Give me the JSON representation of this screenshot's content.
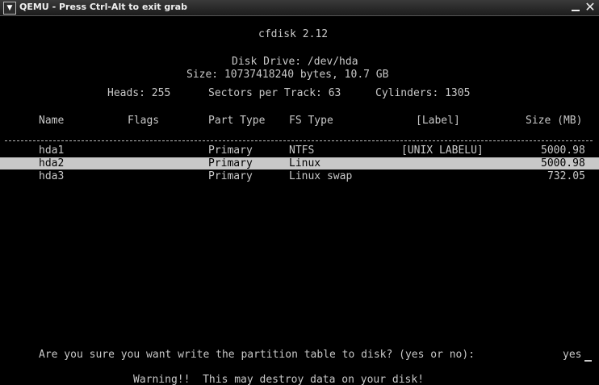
{
  "window": {
    "title": "QEMU - Press Ctrl-Alt to exit grab"
  },
  "header": {
    "program": "cfdisk 2.12",
    "drive": "Disk Drive: /dev/hda",
    "size": "Size: 10737418240 bytes, 10.7 GB",
    "heads": "Heads: 255",
    "sectors": "Sectors per Track: 63",
    "cylinders": "Cylinders: 1305"
  },
  "columns": {
    "name": "Name",
    "flags": "Flags",
    "part_type": "Part Type",
    "fs_type": "FS Type",
    "label": "[Label]",
    "size": "Size (MB)"
  },
  "partitions": [
    {
      "name": "hda1",
      "flags": "",
      "part_type": "Primary",
      "fs_type": "NTFS",
      "label": "[UNIX LABELU]",
      "size": "5000.98"
    },
    {
      "name": "hda2",
      "flags": "",
      "part_type": "Primary",
      "fs_type": "Linux",
      "label": "",
      "size": "5000.98"
    },
    {
      "name": "hda3",
      "flags": "",
      "part_type": "Primary",
      "fs_type": "Linux swap",
      "label": "",
      "size": "732.05"
    }
  ],
  "selected_row": 2,
  "prompt": {
    "question": "Are you sure you want write the partition table to disk? (yes or no):",
    "answer": "yes",
    "warning": "Warning!!  This may destroy data on your disk!"
  }
}
